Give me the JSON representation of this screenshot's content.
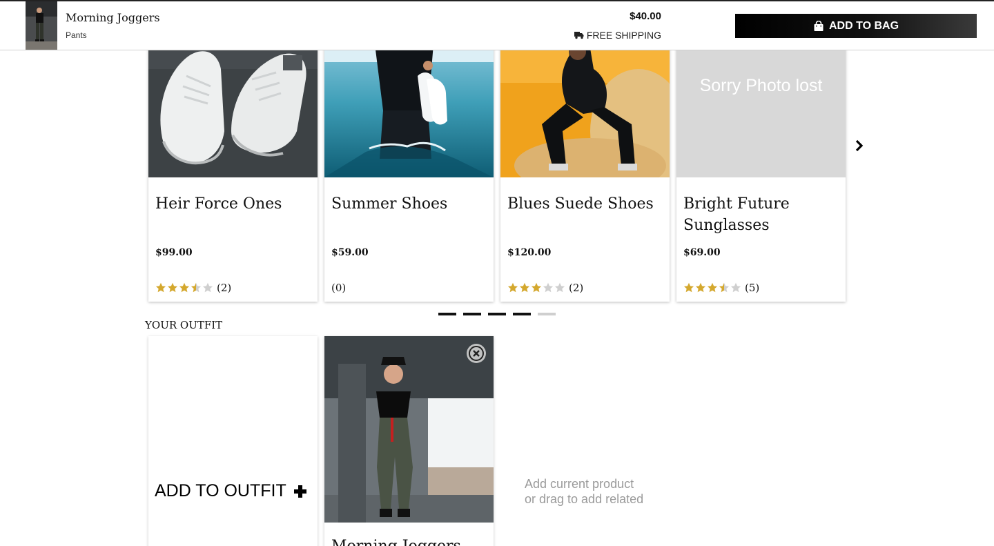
{
  "header": {
    "product_name": "Morning Joggers",
    "category": "Pants",
    "price": "$40.00",
    "shipping": "FREE SHIPPING",
    "add_to_bag": "ADD TO BAG",
    "icons": {
      "shipping": "truck-icon",
      "bag": "shopping-bag-icon"
    }
  },
  "related": {
    "items": [
      {
        "name": "Heir Force Ones",
        "price": "$99.00",
        "rating": 3.5,
        "reviews": "(2)"
      },
      {
        "name": "Summer Shoes",
        "price": "$59.00",
        "rating": 0,
        "reviews": "(0)"
      },
      {
        "name": "Blues Suede Shoes",
        "price": "$120.00",
        "rating": 3,
        "reviews": "(2)"
      },
      {
        "name": "Bright Future Sunglasses",
        "price": "$69.00",
        "rating": 3.5,
        "reviews": "(5)",
        "image_missing_text": "Sorry Photo lost"
      }
    ],
    "next_icon": "chevron-right-icon",
    "pagination": {
      "total": 5,
      "active": [
        0,
        1,
        2,
        3
      ]
    }
  },
  "outfit": {
    "title": "YOUR OUTFIT",
    "add_label": "ADD TO OUTFIT",
    "add_icon": "plus-icon",
    "remove_icon": "close-circle-icon",
    "item": {
      "name": "Morning Joggers"
    },
    "hint_line1": "Add current product",
    "hint_line2": "or drag to add related"
  },
  "colors": {
    "star": "#d4a82e",
    "star_empty": "#cfcfcf",
    "button_bg": "#000000",
    "hint": "#9a9a9a"
  }
}
